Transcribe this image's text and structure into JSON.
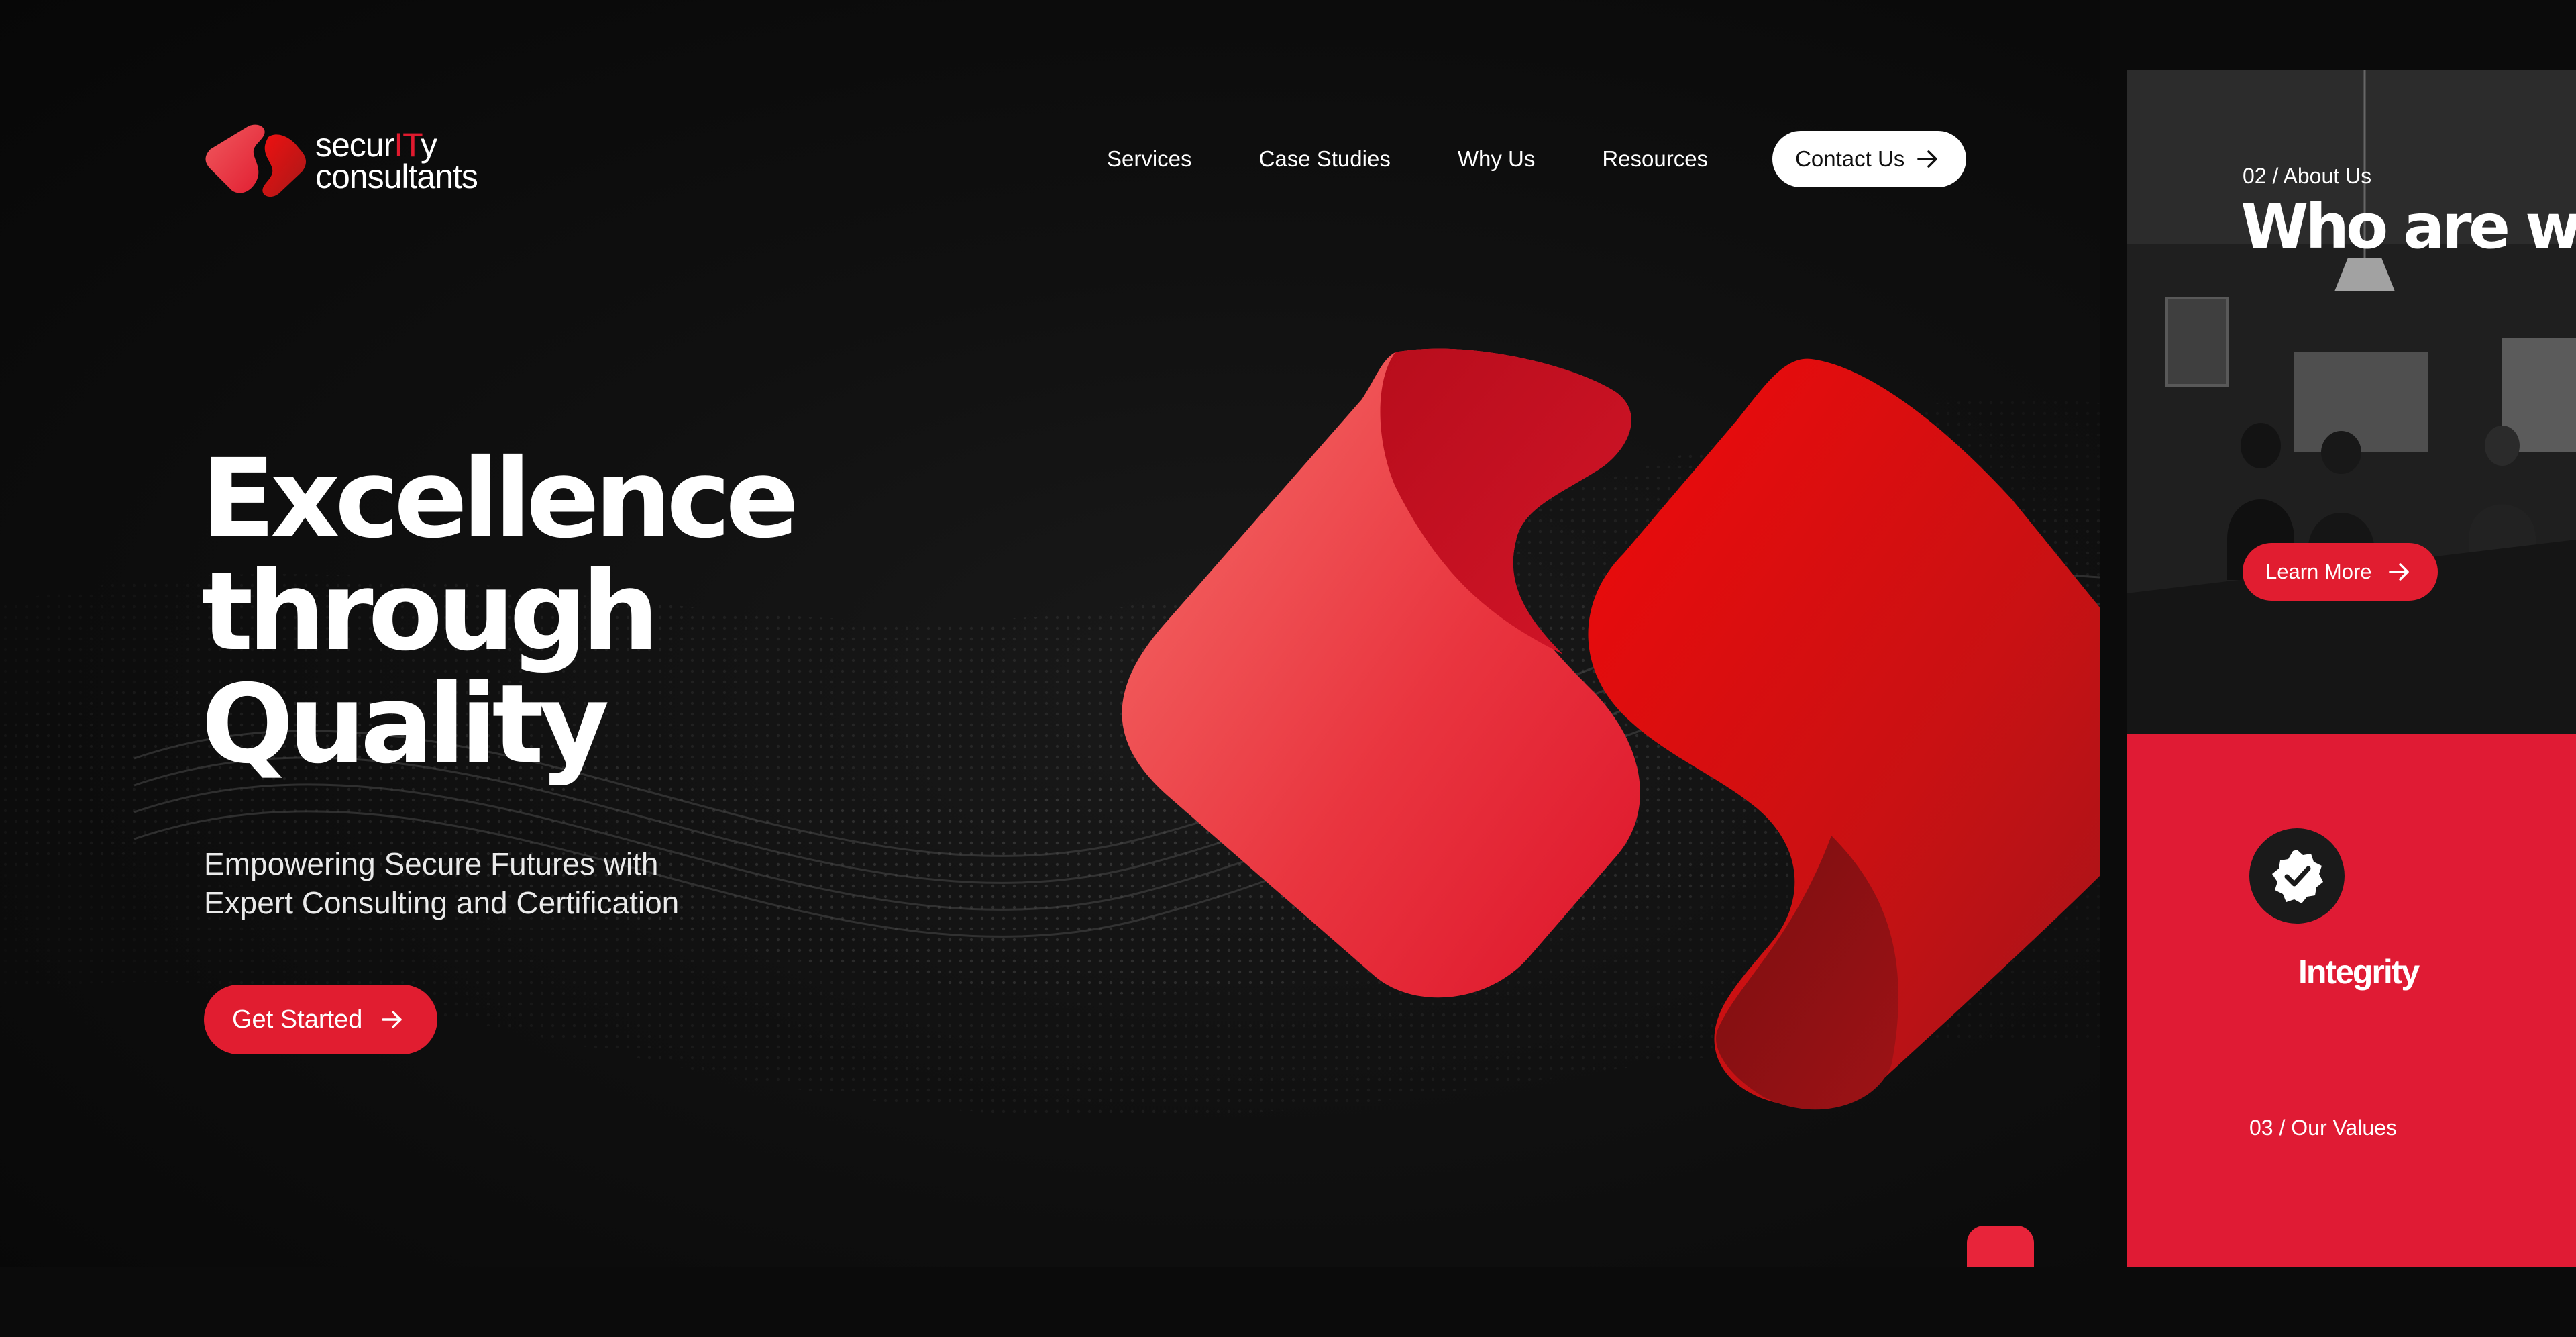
{
  "brand": {
    "logo_line1_prefix": "secur",
    "logo_line1_accent": "IT",
    "logo_line1_suffix": "y",
    "logo_line2": "consultants",
    "accent_color": "#e11d30"
  },
  "nav": {
    "items": [
      "Services",
      "Case Studies",
      "Why Us",
      "Resources"
    ],
    "contact_label": "Contact Us"
  },
  "hero": {
    "headline_line1": "Excellence",
    "headline_line2": "through",
    "headline_line3": "Quality",
    "subhead_line1": "Empowering Secure Futures with",
    "subhead_line2": "Expert Consulting and Certification",
    "cta_label": "Get Started"
  },
  "about": {
    "kicker": "02 / About Us",
    "title": "Who are we?",
    "cta_label": "Learn More"
  },
  "values": {
    "item_label": "Integrity",
    "kicker": "03 / Our Values"
  },
  "icons": {
    "arrow": "arrow-right-icon",
    "badge": "verified-check-icon"
  }
}
